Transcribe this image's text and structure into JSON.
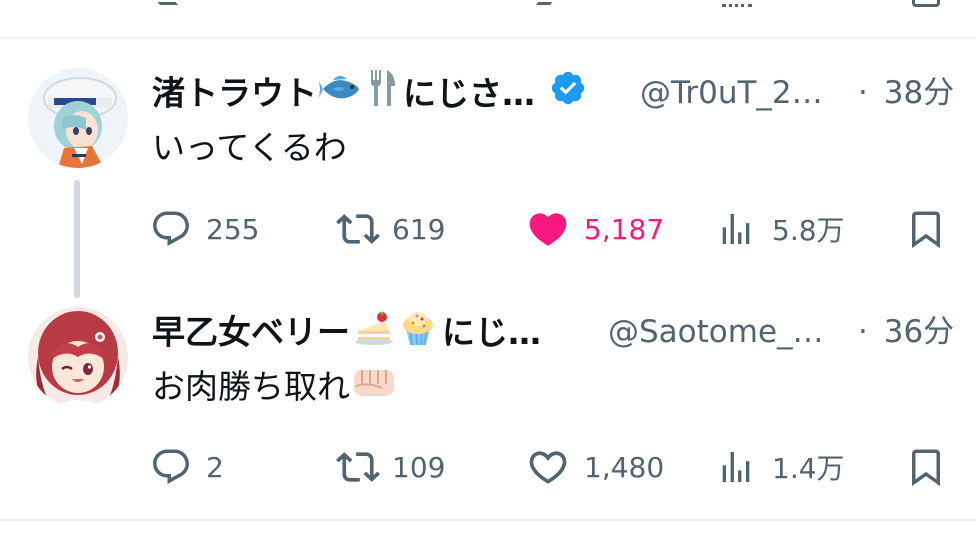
{
  "colors": {
    "text_primary": "#0f1419",
    "text_secondary": "#536471",
    "like_active": "#f91880",
    "verified": "#1d9bf0",
    "divider": "#eff3f4"
  },
  "tweets": [
    {
      "display_name": "渚トラウト🐟🍴にじさ…",
      "name_text": "渚トラウト",
      "name_suffix": "にじさ…",
      "emojis": [
        "fish-emoji",
        "fork-knife-emoji"
      ],
      "verified": true,
      "handle": "@Tr0uT_2…",
      "separator": "·",
      "time": "38分",
      "text": "いってくるわ",
      "replies": "255",
      "retweets": "619",
      "likes": "5,187",
      "liked": true,
      "views": "5.8万",
      "avatar": "avatar-light-blue-hair-chef-hat"
    },
    {
      "display_name": "早乙女ベリー🍰🧁にじ…",
      "name_text": "早乙女ベリー",
      "name_suffix": "にじ…",
      "emojis": [
        "shortcake-emoji",
        "cupcake-emoji"
      ],
      "verified": false,
      "handle": "@Saotome_…",
      "separator": "·",
      "time": "36分",
      "text": "お肉勝ち取れ",
      "text_emoji": "fist-emoji",
      "replies": "2",
      "retweets": "109",
      "likes": "1,480",
      "liked": false,
      "views": "1.4万",
      "avatar": "avatar-red-hair-winking"
    }
  ]
}
